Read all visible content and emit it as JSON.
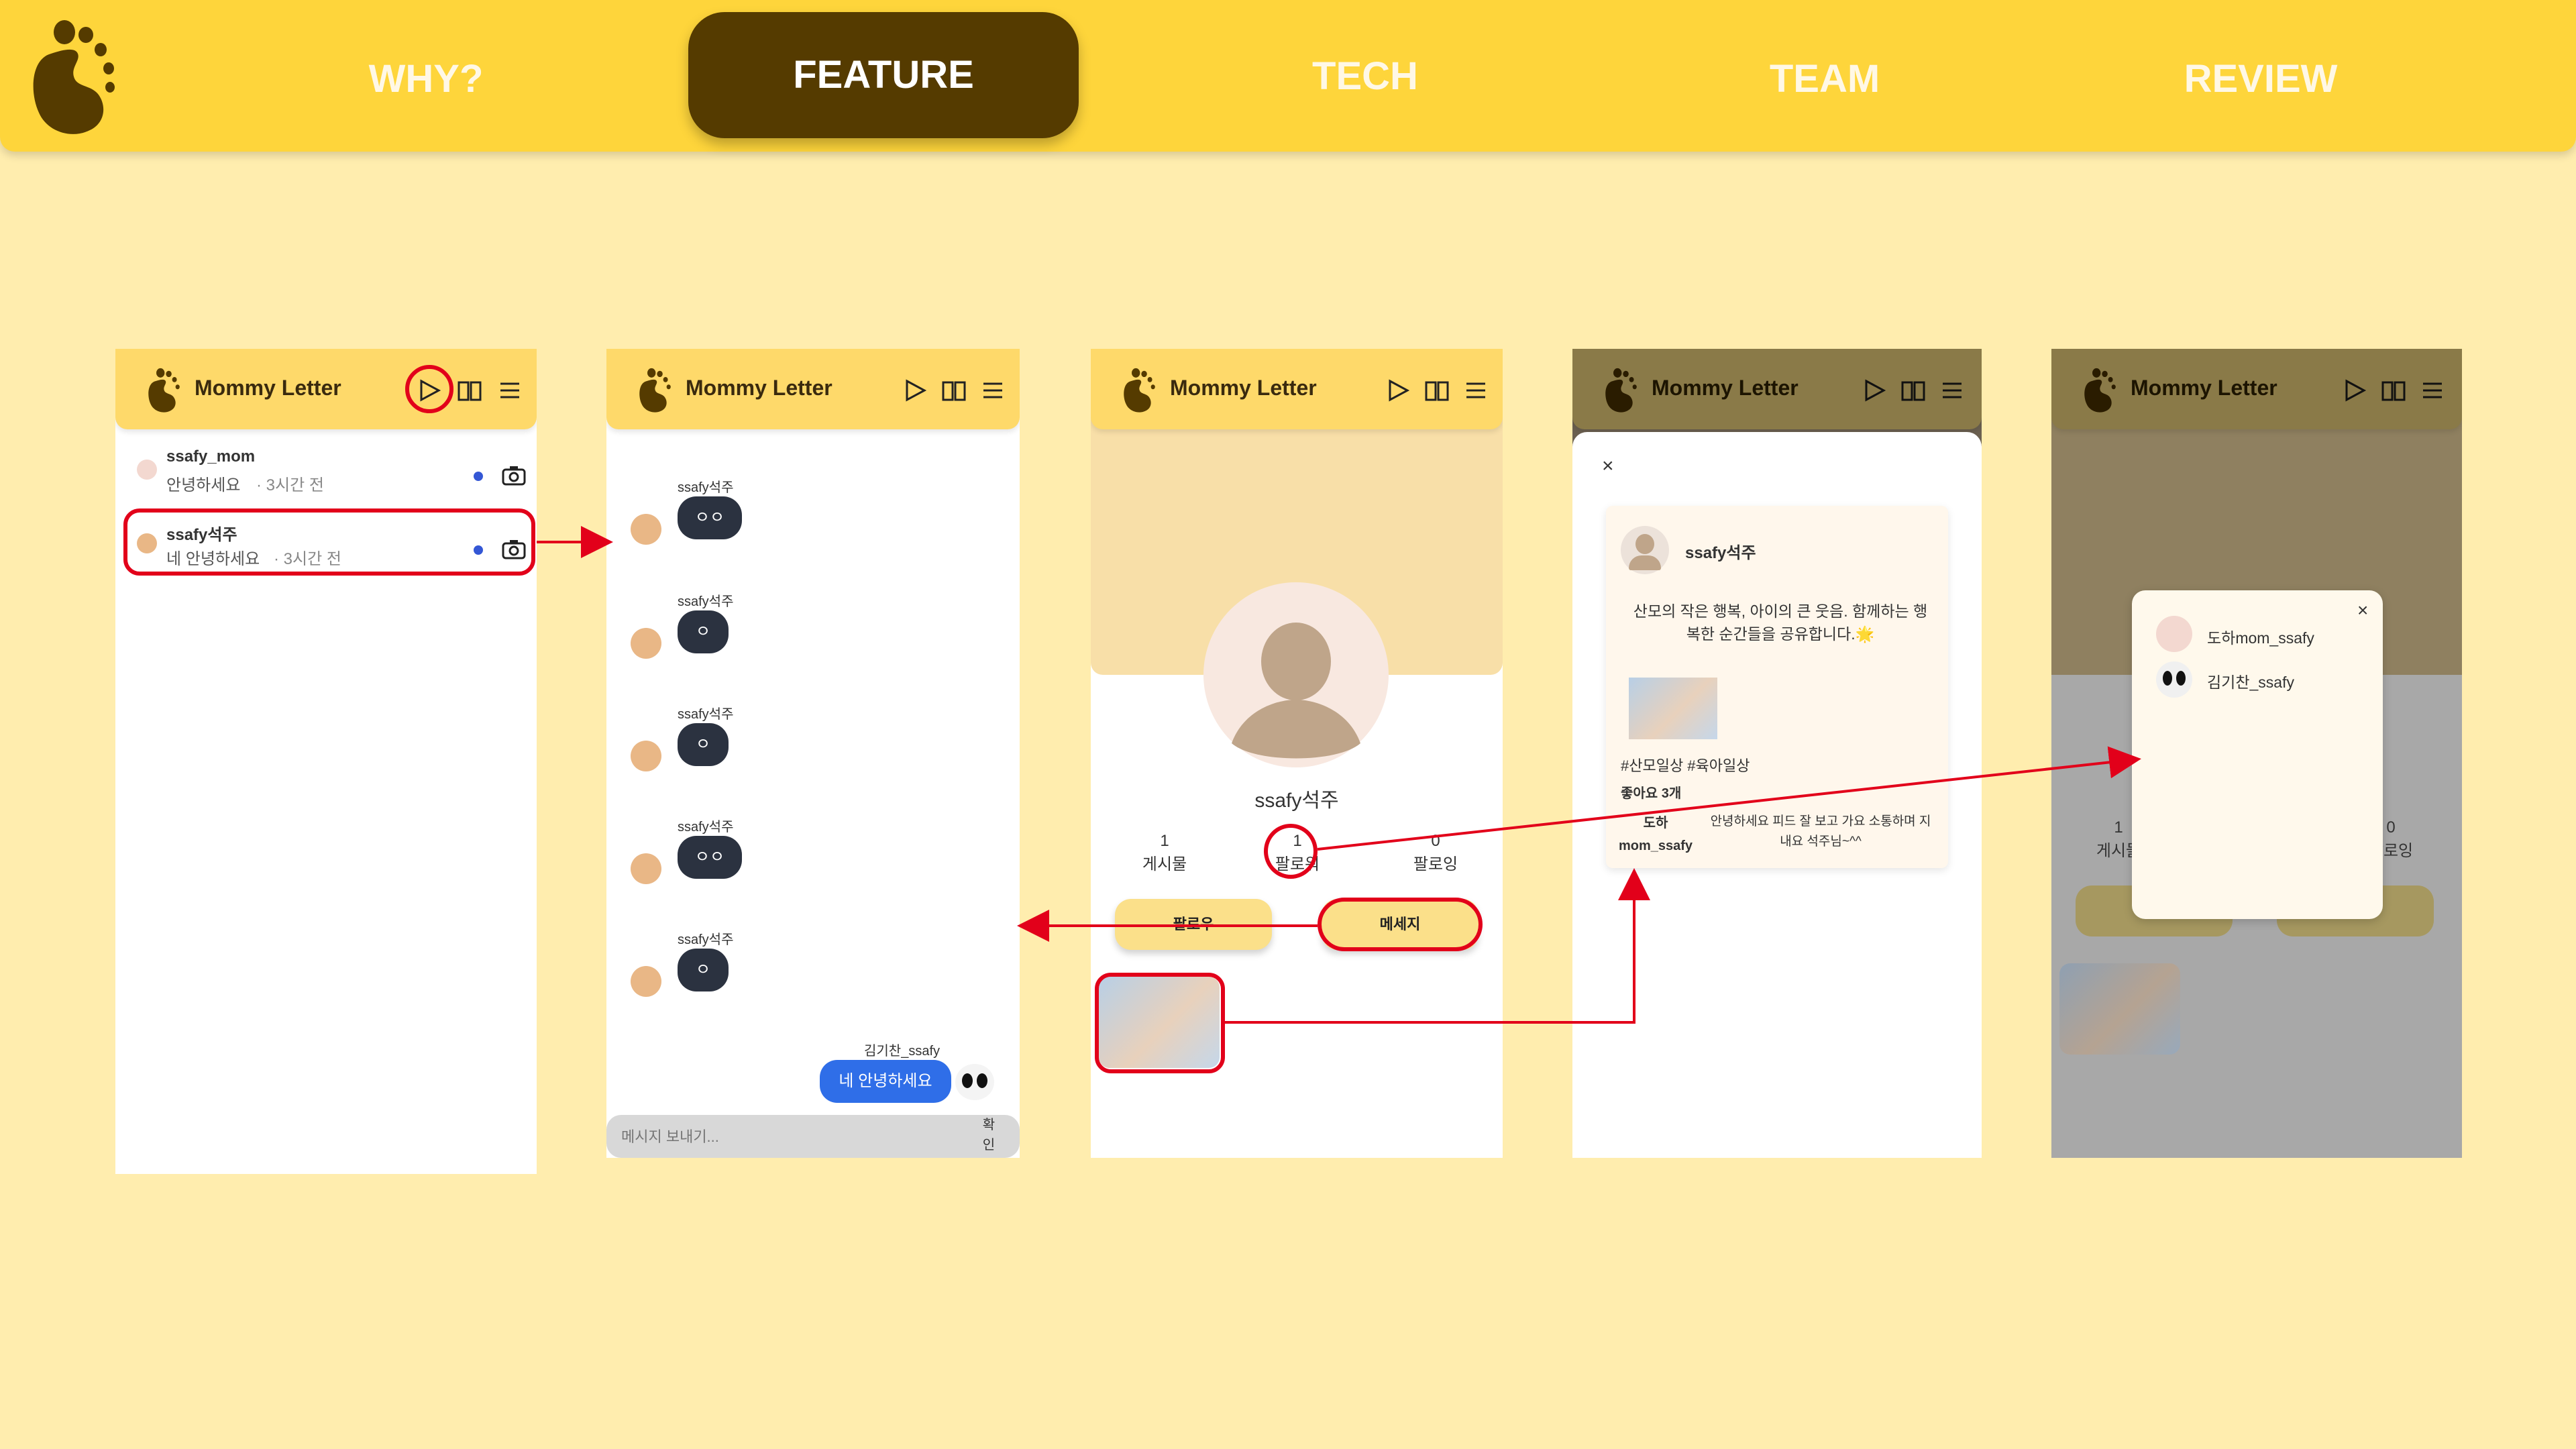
{
  "nav": {
    "items": [
      "WHY?",
      "FEATURE",
      "TECH",
      "TEAM",
      "REVIEW"
    ],
    "active": "FEATURE"
  },
  "app": {
    "title": "Mommy Letter"
  },
  "chat_list": {
    "rows": [
      {
        "name": "ssafy_mom",
        "message": "안녕하세요",
        "time": "· 3시간 전"
      },
      {
        "name": "ssafy석주",
        "message": "네 안녕하세요",
        "time": "· 3시간 전"
      }
    ]
  },
  "chat_room": {
    "sender": "ssafy석주",
    "bubbles": [
      "ㅇㅇ",
      "ㅇ",
      "ㅇ",
      "ㅇㅇ",
      "ㅇ"
    ],
    "me": {
      "name": "김기찬_ssafy",
      "message": "네 안녕하세요"
    },
    "input_placeholder": "메시지 보내기...",
    "send_label": "확인"
  },
  "profile": {
    "username": "ssafy석주",
    "stats": [
      {
        "value": "1",
        "label": "게시물"
      },
      {
        "value": "1",
        "label": "팔로워"
      },
      {
        "value": "0",
        "label": "팔로잉"
      }
    ],
    "follow_button": "팔로우",
    "message_button": "메세지"
  },
  "post_modal": {
    "close": "×",
    "author": "ssafy석주",
    "caption": "산모의 작은 행복, 아이의 큰 웃음. 함께하는 행복한 순간들을 공유합니다.🌟",
    "tags": "#산모일상 #육아일상",
    "likes": "좋아요 3개",
    "comment_author": "도하mom_ssafy",
    "comment_text": "안녕하세요 피드 잘 보고 가요 소통하며 지내요 석주님~^^"
  },
  "followers_modal": {
    "close": "×",
    "users": [
      "도하mom_ssafy",
      "김기찬_ssafy"
    ],
    "stats": [
      {
        "value": "1",
        "label": "게시물"
      },
      {
        "value": "0",
        "label": "팔로잉"
      }
    ]
  },
  "colors": {
    "nav_bg": "#FED53B",
    "active_pill": "#553B00",
    "page_bg": "#FFEDAE",
    "annotation": "#E2001A",
    "my_bubble": "#2F6EE8"
  }
}
